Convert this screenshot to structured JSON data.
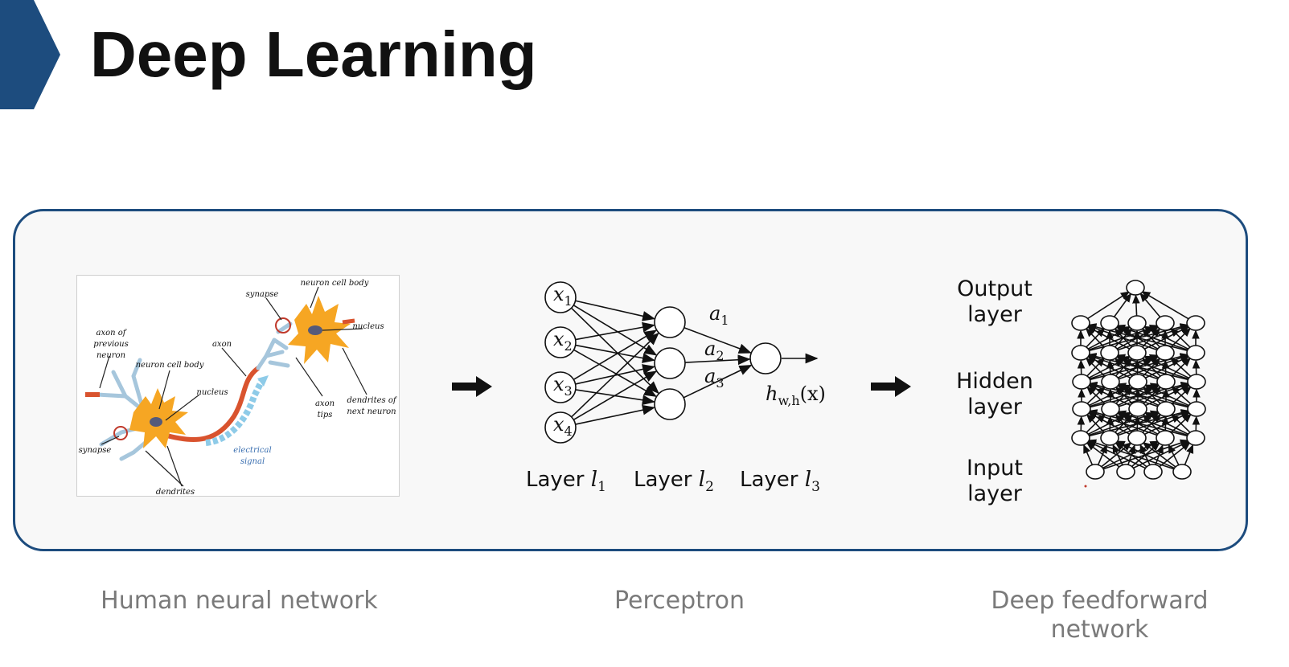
{
  "header": {
    "title": "Deep Learning"
  },
  "neuron_figure": {
    "labels": {
      "synapse_top": "synapse",
      "cell_body_top": "neuron cell body",
      "nucleus_top": "nucleus",
      "axon_prev_1": "axon of",
      "axon_prev_2": "previous",
      "axon_prev_3": "neuron",
      "cell_body_left": "neuron cell body",
      "axon": "axon",
      "nucleus_left": "nucleus",
      "axon_tips_1": "axon",
      "axon_tips_2": "tips",
      "dendrites_next_1": "dendrites of",
      "dendrites_next_2": "next neuron",
      "synapse_left": "synapse",
      "electrical_1": "electrical",
      "electrical_2": "signal",
      "dendrites": "dendrites"
    }
  },
  "perceptron": {
    "inputs": [
      {
        "sym": "x",
        "sub": "1"
      },
      {
        "sym": "x",
        "sub": "2"
      },
      {
        "sym": "x",
        "sub": "3"
      },
      {
        "sym": "x",
        "sub": "4"
      }
    ],
    "activations": [
      {
        "sym": "a",
        "sub": "1"
      },
      {
        "sym": "a",
        "sub": "2"
      },
      {
        "sym": "a",
        "sub": "3"
      }
    ],
    "output": {
      "sym": "h",
      "sub": "w,h",
      "arg": "(x)"
    },
    "layers": [
      {
        "prefix": "Layer ",
        "sym": "l",
        "sub": "1"
      },
      {
        "prefix": "Layer ",
        "sym": "l",
        "sub": "2"
      },
      {
        "prefix": "Layer ",
        "sym": "l",
        "sub": "3"
      }
    ]
  },
  "deep_network": {
    "output_label": {
      "line1": "Output",
      "line2": "layer"
    },
    "hidden_label": {
      "line1": "Hidden",
      "line2": "layer"
    },
    "input_label": {
      "line1": "Input",
      "line2": "layer"
    }
  },
  "captions": {
    "human": "Human neural network",
    "perceptron": "Perceptron",
    "deep_line1": "Deep feedforward",
    "deep_line2": "network"
  },
  "colors": {
    "accent": "#1d4c7e",
    "neuron_orange": "#f6a623",
    "signal_blue": "#8ecbe8",
    "caption_gray": "#7a7a7a"
  },
  "icons": [
    "chevron-right-icon",
    "arrow-right-icon"
  ]
}
